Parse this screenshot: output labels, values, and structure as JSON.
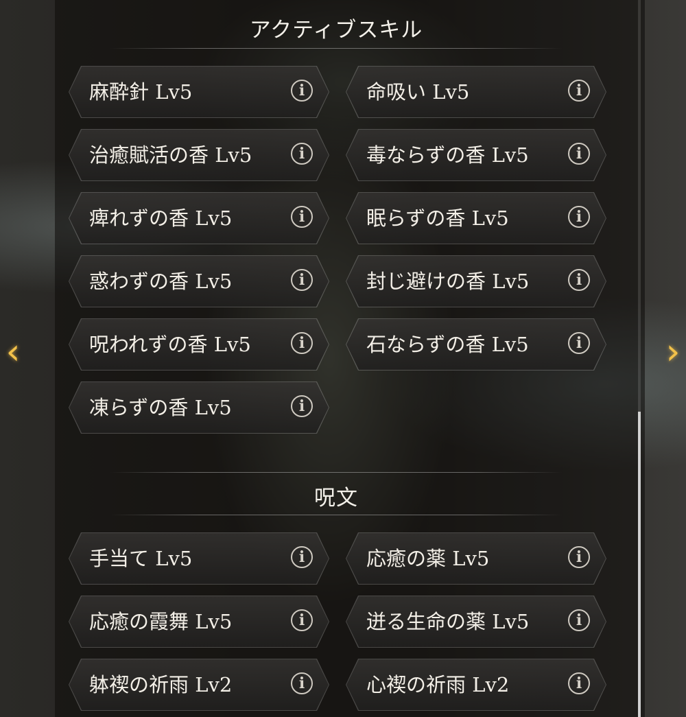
{
  "active_skills": {
    "title": "アクティブスキル",
    "items": [
      {
        "label": "麻酔針 Lv5"
      },
      {
        "label": "命吸い Lv5"
      },
      {
        "label": "治癒賦活の香 Lv5"
      },
      {
        "label": "毒ならずの香 Lv5"
      },
      {
        "label": "痺れずの香 Lv5"
      },
      {
        "label": "眠らずの香 Lv5"
      },
      {
        "label": "惑わずの香 Lv5"
      },
      {
        "label": "封じ避けの香 Lv5"
      },
      {
        "label": "呪われずの香 Lv5"
      },
      {
        "label": "石ならずの香 Lv5"
      },
      {
        "label": "凍らずの香 Lv5"
      }
    ]
  },
  "spells": {
    "title": "呪文",
    "items": [
      {
        "label": "手当て Lv5"
      },
      {
        "label": "応癒の薬 Lv5"
      },
      {
        "label": "応癒の霞舞 Lv5"
      },
      {
        "label": "迸る生命の薬 Lv5"
      },
      {
        "label": "躰禊の祈雨 Lv2"
      },
      {
        "label": "心禊の祈雨 Lv2"
      }
    ]
  },
  "info_icon_glyph": "i",
  "nav": {
    "left_glyph": "‹",
    "right_glyph": "›"
  },
  "colors": {
    "arrow": "#f2c14a",
    "text": "#f3efe7"
  }
}
